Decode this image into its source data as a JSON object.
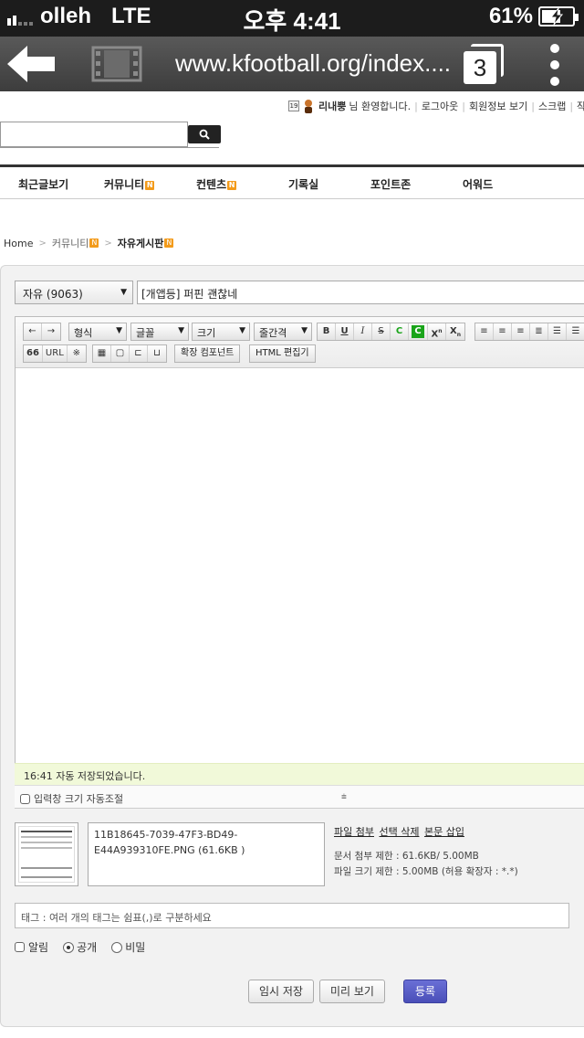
{
  "status_bar": {
    "carrier": "olleh",
    "network": "LTE",
    "time": "오후 4:41",
    "battery": "61%",
    "battery_level": 0.61
  },
  "browser": {
    "url": "www.kfootball.org/index....",
    "tab_count": "3"
  },
  "user_bar": {
    "level": "19",
    "username": "리내뿡",
    "greeting": "님 환영합니다.",
    "links": [
      "로그아웃",
      "회원정보 보기",
      "스크랩",
      "작성"
    ]
  },
  "search": {
    "placeholder": ""
  },
  "nav": {
    "items": [
      {
        "label": "최근글보기",
        "badge": ""
      },
      {
        "label": "커뮤니티",
        "badge": "N"
      },
      {
        "label": "컨텐츠",
        "badge": "N"
      },
      {
        "label": "기록실",
        "badge": ""
      },
      {
        "label": "포인트존",
        "badge": ""
      },
      {
        "label": "어워드",
        "badge": ""
      }
    ]
  },
  "breadcrumb": {
    "home": "Home",
    "section": "커뮤니티",
    "section_badge": "N",
    "current": "자유게시판",
    "current_badge": "N"
  },
  "form": {
    "category": "자유 (9063)",
    "title": "[개앱등] 퍼핀 괜찮네",
    "toolbar": {
      "format": "형식",
      "font": "글꼴",
      "size": "크기",
      "line_height": "줄간격",
      "bold": "B",
      "underline": "U",
      "italic": "I",
      "strike": "S",
      "font_color": "C",
      "bg_color": "C",
      "superscript": "X",
      "subscript": "X",
      "quote": "66",
      "url": "URL",
      "special_char": "※",
      "extension": "확장 컴포넌트",
      "html_editor": "HTML 편집기"
    },
    "autosave_message": "16:41 자동 저장되었습니다.",
    "auto_resize_label": "입력창 크기 자동조절",
    "attachment": {
      "file_line1": "11B18645-7039-47F3-BD49-",
      "file_line2": "E44A939310FE.PNG (61.6KB )",
      "attach_link": "파일 첨부",
      "delete_link": "선택 삭제",
      "insert_link": "본문 삽입",
      "doc_limit": "문서 첨부 제한 : 61.6KB/ 5.00MB",
      "file_limit": "파일 크기 제한 : 5.00MB (허용 확장자 : *.*)"
    },
    "tag_placeholder": "태그 : 여러 개의 태그는 쉼표(,)로 구분하세요",
    "options": {
      "notify": "알림",
      "public": "공개",
      "secret": "비밀",
      "selected": "공개"
    },
    "buttons": {
      "temp_save": "임시 저장",
      "preview": "미리 보기",
      "submit": "등록"
    }
  }
}
